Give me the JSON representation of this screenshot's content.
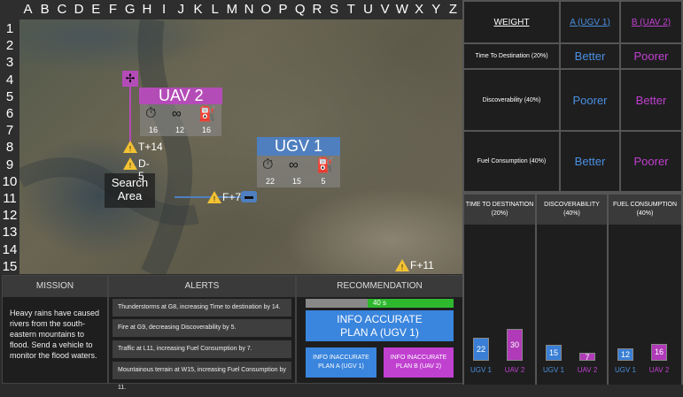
{
  "grid": {
    "columns": [
      "A",
      "B",
      "C",
      "D",
      "E",
      "F",
      "G",
      "H",
      "I",
      "J",
      "K",
      "L",
      "M",
      "N",
      "O",
      "P",
      "Q",
      "R",
      "S",
      "T",
      "U",
      "V",
      "W",
      "X",
      "Y",
      "Z"
    ],
    "rows": [
      "1",
      "2",
      "3",
      "4",
      "5",
      "6",
      "7",
      "8",
      "9",
      "10",
      "11",
      "12",
      "13",
      "14",
      "15"
    ]
  },
  "map": {
    "uav": {
      "label": "UAV 2",
      "values": [
        "16",
        "12",
        "16"
      ],
      "icons": [
        "stopwatch-icon",
        "binoculars-icon",
        "fuel-pump-icon"
      ]
    },
    "ugv": {
      "label": "UGV 1",
      "values": [
        "22",
        "15",
        "5"
      ],
      "icons": [
        "stopwatch-icon",
        "binoculars-icon",
        "fuel-pump-icon"
      ]
    },
    "search_area": "Search\nArea",
    "markers": [
      {
        "id": "t14",
        "label": "T+14"
      },
      {
        "id": "d5",
        "label": "D-5"
      },
      {
        "id": "f7",
        "label": "F+7"
      },
      {
        "id": "f11",
        "label": "F+11"
      }
    ],
    "colors": {
      "uav": "#b44cb8",
      "ugv": "#4f7fbf",
      "warning": "#f3c233"
    }
  },
  "mission": {
    "header": "MISSION",
    "text": "Heavy rains have caused rivers from the south-eastern mountains to flood. Send a vehicle to monitor the flood waters."
  },
  "alerts": {
    "header": "ALERTS",
    "items": [
      "Thunderstorms at G8, increasing Time to destination by 14.",
      "Fire at G9, decreasing Discoverability by 5.",
      "Traffic at L11, increasing Fuel Consumption by 7.",
      "Mountainous terrain at W15, increasing Fuel Consumption by 11."
    ]
  },
  "recommendation": {
    "header": "RECOMMENDATION",
    "timer": "40 s",
    "timer_fraction": 0.58,
    "main_button": "INFO ACCURATE\nPLAN A (UGV 1)",
    "btn_a": "INFO INACCURATE\nPLAN A (UGV 1)",
    "btn_b": "INFO INACCURATE\nPLAN B (UAV 2)"
  },
  "comparison": {
    "weight_header": "WEIGHT",
    "col_a": "A (UGV 1)",
    "col_b": "B (UAV 2)",
    "rows": [
      {
        "label": "Time To Destination (20%)",
        "a": "Better",
        "b": "Poorer"
      },
      {
        "label": "Discoverability (40%)",
        "a": "Poorer",
        "b": "Better"
      },
      {
        "label": "Fuel Consumption (40%)",
        "a": "Better",
        "b": "Poorer"
      }
    ],
    "colors": {
      "a": "#4a90e2",
      "b": "#c040d0"
    }
  },
  "chart_data": {
    "type": "bar",
    "groups": [
      {
        "title": "TIME TO DESTINATION\n(20%)",
        "categories": [
          "UGV 1",
          "UAV 2"
        ],
        "values": [
          22,
          30
        ]
      },
      {
        "title": "DISCOVERABILITY\n(40%)",
        "categories": [
          "UGV 1",
          "UAV 2"
        ],
        "values": [
          15,
          7
        ]
      },
      {
        "title": "FUEL CONSUMPTION\n(40%)",
        "categories": [
          "UGV 1",
          "UAV 2"
        ],
        "values": [
          12,
          16
        ]
      }
    ],
    "ylim": [
      0,
      100
    ],
    "colors": [
      "#3a7fd5",
      "#b03ab8"
    ]
  }
}
